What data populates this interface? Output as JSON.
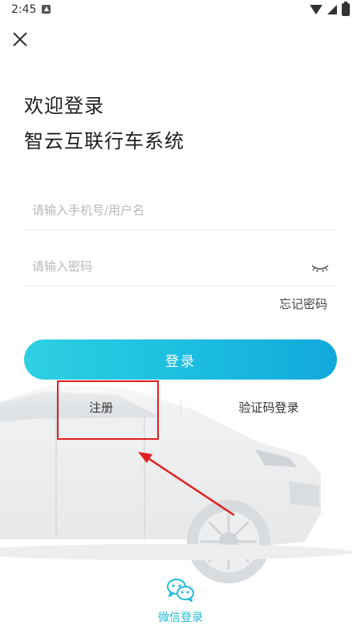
{
  "status_bar": {
    "time": "2:45"
  },
  "header": {
    "welcome": "欢迎登录",
    "system_name": "智云互联行车系统"
  },
  "form": {
    "phone_placeholder": "请输入手机号/用户名",
    "password_placeholder": "请输入密码",
    "forgot_label": "忘记密码",
    "login_label": "登录"
  },
  "links": {
    "register_label": "注册",
    "verify_login_label": "验证码登录"
  },
  "wechat": {
    "label": "微信登录"
  },
  "colors": {
    "accent_start": "#2fd0e2",
    "accent_end": "#12a9dc",
    "annotation": "#e02020",
    "wechat_label": "#1fbcd6"
  },
  "icons": [
    "close-icon",
    "eye-closed-icon",
    "wechat-icon",
    "wifi-icon",
    "signal-icon",
    "battery-icon"
  ]
}
